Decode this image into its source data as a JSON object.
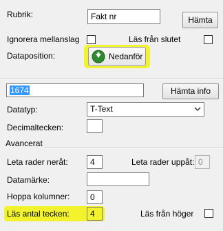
{
  "rubrik": {
    "label": "Rubrik:",
    "value": "Fakt nr",
    "fetch_button": "Hämta"
  },
  "options": {
    "ignore_spaces_label": "Ignorera mellanslag",
    "read_from_end_label": "Läs från slutet"
  },
  "data_position": {
    "label": "Dataposition:",
    "button_label": "Nedanför",
    "icon": "arrow-down-circle-icon"
  },
  "info": {
    "value": "1674",
    "fetch_info_button": "Hämta info"
  },
  "datatype": {
    "label": "Datatyp:",
    "selected": "T-Text"
  },
  "decimal": {
    "label": "Decimaltecken:",
    "value": ""
  },
  "advanced": {
    "section_title": "Avancerat",
    "search_rows_down_label": "Leta rader neråt:",
    "search_rows_down_value": "4",
    "search_rows_up_label": "Leta rader uppåt:",
    "search_rows_up_value": "0",
    "data_marker_label": "Datamärke:",
    "data_marker_value": "",
    "skip_columns_label": "Hoppa kolumner:",
    "skip_columns_value": "0",
    "read_char_count_label": "Läs antal tecken:",
    "read_char_count_value": "4",
    "read_from_right_label": "Läs från höger"
  },
  "colors": {
    "highlight": "#f3f32d",
    "selection": "#3399ff",
    "icon_green": "#2e8b2e"
  }
}
